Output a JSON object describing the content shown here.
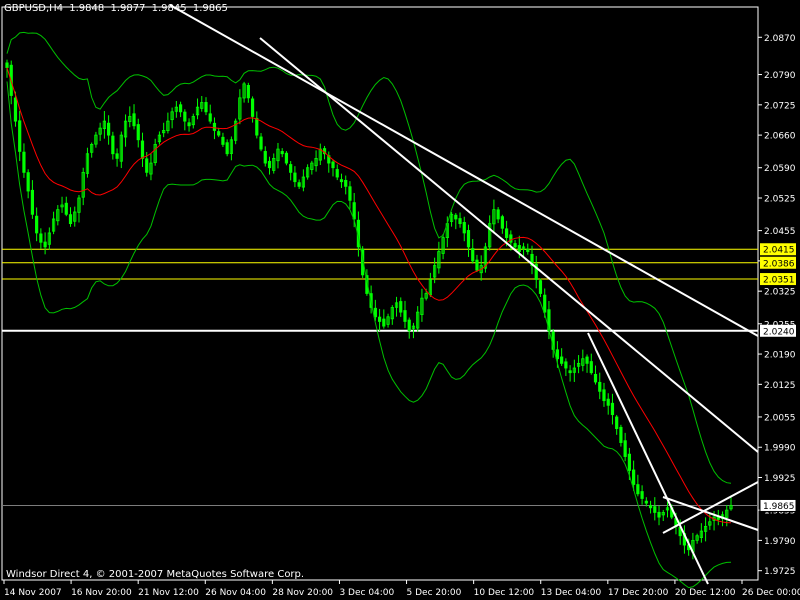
{
  "header": {
    "symbol": "GBPUSD,H4",
    "open": "1.9848",
    "high": "1.9877",
    "low": "1.9845",
    "close": "1.9865"
  },
  "footer": {
    "copyright": "Windsor Direct 4, © 2001-2007 MetaQuotes Software Corp."
  },
  "colors": {
    "background": "#000000",
    "axis": "#ffffff",
    "candle": "#00ff00",
    "ma": "#ff0000",
    "bands": "#00c000",
    "trendline": "#ffffff",
    "level_line": "#ffff00",
    "level_label_bg": "#ffff00",
    "level_label_text": "#000000",
    "current_price_line": "#7c7c7c"
  },
  "chart_data": {
    "type": "candlestick",
    "title": "GBPUSD,H4",
    "y_ticks": [
      "2.0870",
      "2.0790",
      "2.0725",
      "2.0660",
      "2.0590",
      "2.0525",
      "2.0455",
      "2.0390",
      "2.0325",
      "2.0255",
      "2.0190",
      "2.0125",
      "2.0055",
      "1.9990",
      "1.9925",
      "1.9855",
      "1.9790",
      "1.9725"
    ],
    "x_ticks": [
      "14 Nov 2007",
      "16 Nov 20:00",
      "21 Nov 12:00",
      "26 Nov 04:00",
      "28 Nov 20:00",
      "3 Dec 04:00",
      "5 Dec 20:00",
      "10 Dec 12:00",
      "13 Dec 04:00",
      "17 Dec 20:00",
      "20 Dec 12:00",
      "26 Dec 00:00"
    ],
    "ylim": [
      1.9705,
      2.0935
    ],
    "price_labels": [
      {
        "value": "2.0415",
        "style": "yellow"
      },
      {
        "value": "2.0386",
        "style": "yellow"
      },
      {
        "value": "2.0351",
        "style": "yellow"
      },
      {
        "value": "2.0240",
        "style": "white"
      },
      {
        "value": "1.9865",
        "style": "current"
      }
    ],
    "levels": [
      2.0415,
      2.0386,
      2.0351
    ],
    "support_level": 2.024,
    "current_price": 1.9865,
    "close_series": [
      2.0805,
      2.0745,
      2.069,
      2.0625,
      2.058,
      2.054,
      2.049,
      2.045,
      2.043,
      2.042,
      2.045,
      2.048,
      2.05,
      2.051,
      2.049,
      2.047,
      2.0495,
      2.0525,
      2.058,
      2.062,
      2.064,
      2.066,
      2.0675,
      2.069,
      2.066,
      2.062,
      2.061,
      2.066,
      2.069,
      2.07,
      2.068,
      2.065,
      2.061,
      2.058,
      2.06,
      2.064,
      2.066,
      2.067,
      2.069,
      2.071,
      2.072,
      2.071,
      2.069,
      2.068,
      2.07,
      2.072,
      2.073,
      2.071,
      2.069,
      2.067,
      2.066,
      2.064,
      2.062,
      2.065,
      2.069,
      2.074,
      2.077,
      2.074,
      2.07,
      2.066,
      2.063,
      2.06,
      2.059,
      2.061,
      2.063,
      2.062,
      2.06,
      2.058,
      2.056,
      2.055,
      2.057,
      2.059,
      2.06,
      2.061,
      2.063,
      2.062,
      2.06,
      2.059,
      2.057,
      2.056,
      2.055,
      2.052,
      2.048,
      2.042,
      2.036,
      2.032,
      2.029,
      2.027,
      2.026,
      2.025,
      2.027,
      2.029,
      2.03,
      2.028,
      2.026,
      2.024,
      2.025,
      2.028,
      2.031,
      2.032,
      2.035,
      2.038,
      2.041,
      2.044,
      2.047,
      2.049,
      2.048,
      2.047,
      2.045,
      2.042,
      2.039,
      2.037,
      2.038,
      2.042,
      2.047,
      2.05,
      2.048,
      2.046,
      2.044,
      2.043,
      2.042,
      2.041,
      2.042,
      2.041,
      2.038,
      2.035,
      2.032,
      2.028,
      2.024,
      2.02,
      2.018,
      2.017,
      2.016,
      2.015,
      2.016,
      2.017,
      2.018,
      2.017,
      2.015,
      2.013,
      2.011,
      2.009,
      2.008,
      2.006,
      2.003,
      2.0,
      1.997,
      1.994,
      1.991,
      1.989,
      1.988,
      1.987,
      1.986,
      1.985,
      1.984,
      1.985,
      1.986,
      1.984,
      1.982,
      1.98,
      1.978,
      1.977,
      1.979,
      1.98,
      1.981,
      1.982,
      1.983,
      1.984,
      1.9835,
      1.9845,
      1.9855,
      1.9865
    ]
  }
}
